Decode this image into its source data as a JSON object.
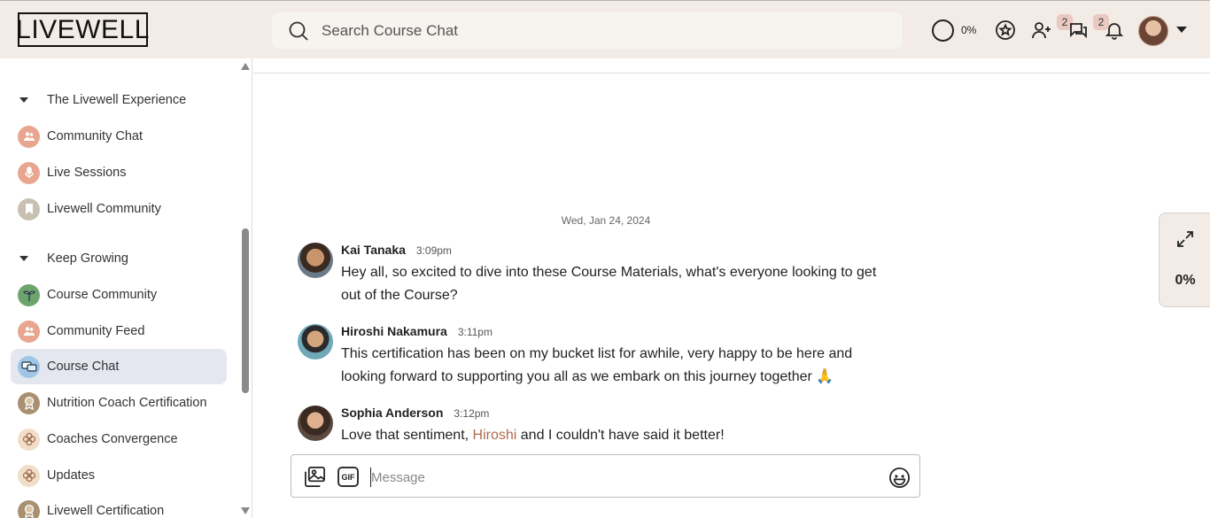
{
  "header": {
    "logo_text": "LIVEWELL",
    "search_placeholder": "Search Course Chat",
    "progress_label": "0%",
    "invites_badge": "2",
    "messages_badge": "2"
  },
  "sidebar": {
    "groups": [
      {
        "title": "The Livewell Experience",
        "items": [
          {
            "label": "Community Chat",
            "icon": "people-icon",
            "color": "#e8a58f"
          },
          {
            "label": "Live Sessions",
            "icon": "microphone-icon",
            "color": "#e8a58f"
          },
          {
            "label": "Livewell Community",
            "icon": "bookmark-icon",
            "color": "#c8c0b0"
          }
        ]
      },
      {
        "title": "Keep Growing",
        "items": [
          {
            "label": "Course Community",
            "icon": "sprout-icon",
            "color": "#6da46d"
          },
          {
            "label": "Community Feed",
            "icon": "people-icon",
            "color": "#e8a58f"
          },
          {
            "label": "Course Chat",
            "icon": "chat-bubbles-icon",
            "color": "#9fc6e6",
            "active": true
          },
          {
            "label": "Nutrition Coach Certification",
            "icon": "award-icon",
            "color": "#a89070"
          },
          {
            "label": "Coaches Convergence",
            "icon": "flower-icon",
            "color": "#f2ddc8"
          },
          {
            "label": "Updates",
            "icon": "flower-icon",
            "color": "#f2ddc8"
          },
          {
            "label": "Livewell Certification",
            "icon": "award-icon",
            "color": "#a89070"
          }
        ]
      }
    ]
  },
  "chat": {
    "date_separator": "Wed, Jan 24, 2024",
    "messages": [
      {
        "author": "Kai Tanaka",
        "time": "3:09pm",
        "text": "Hey all, so excited to dive into these Course Materials, what's everyone looking to get out of the Course?"
      },
      {
        "author": "Hiroshi Nakamura",
        "time": "3:11pm",
        "text": "This certification has been on my bucket list for awhile, very happy to be here and looking forward to supporting you all as we embark on this journey together",
        "emoji": "🙏"
      },
      {
        "author": "Sophia Anderson",
        "time": "3:12pm",
        "text_before": "Love that sentiment, ",
        "mention": "Hiroshi",
        "text_after": " and I couldn't have said it better!"
      }
    ],
    "composer": {
      "placeholder": "Message",
      "gif_label": "GIF"
    }
  },
  "side_panel": {
    "progress_label": "0%"
  },
  "colors": {
    "header_bg": "#f3ece6",
    "active_nav_bg": "#e4e7ef",
    "mention": "#b06a4a"
  }
}
